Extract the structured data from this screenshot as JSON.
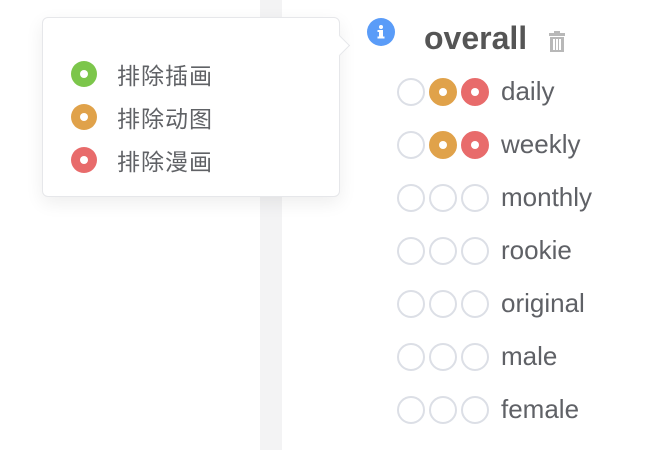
{
  "popover": {
    "items": [
      {
        "label": "排除插画",
        "color": "#7cc64b"
      },
      {
        "label": "排除动图",
        "color": "#e0a24a"
      },
      {
        "label": "排除漫画",
        "color": "#e86b6b"
      }
    ]
  },
  "header": {
    "title": "overall",
    "info_icon": "info-icon",
    "delete_icon": "trash-icon"
  },
  "rows": [
    {
      "label": "daily",
      "states": [
        false,
        true,
        true
      ]
    },
    {
      "label": "weekly",
      "states": [
        false,
        true,
        true
      ]
    },
    {
      "label": "monthly",
      "states": [
        false,
        false,
        false
      ]
    },
    {
      "label": "rookie",
      "states": [
        false,
        false,
        false
      ]
    },
    {
      "label": "original",
      "states": [
        false,
        false,
        false
      ]
    },
    {
      "label": "male",
      "states": [
        false,
        false,
        false
      ]
    },
    {
      "label": "female",
      "states": [
        false,
        false,
        false
      ]
    }
  ],
  "colors": {
    "green": "#7cc64b",
    "orange": "#e0a24a",
    "red": "#e86b6b",
    "info": "#5a9cf8"
  }
}
